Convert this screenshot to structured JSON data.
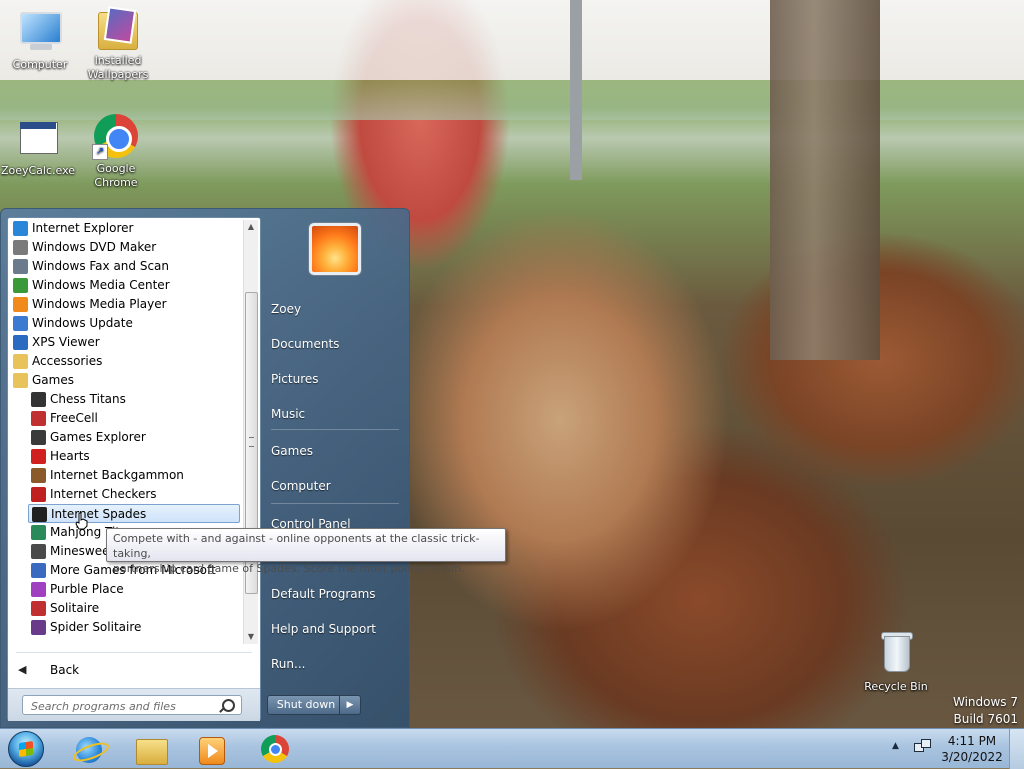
{
  "desktop": {
    "icons": [
      {
        "label": "Computer",
        "icon": "computer-icon"
      },
      {
        "label": "Installed Wallpapers",
        "icon": "folder-icon"
      },
      {
        "label": "ZoeyCalc.exe",
        "icon": "application-icon"
      },
      {
        "label": "Google Chrome",
        "icon": "chrome-icon"
      },
      {
        "label": "Recycle Bin",
        "icon": "recycle-bin-icon"
      }
    ],
    "watermark": {
      "line1": "Windows 7",
      "line2": "Build 7601"
    }
  },
  "start_menu": {
    "programs": [
      {
        "label": "Internet Explorer",
        "icon": "internet-explorer-icon",
        "color": "#2a86d8"
      },
      {
        "label": "Windows DVD Maker",
        "icon": "dvd-maker-icon",
        "color": "#7a7a7a"
      },
      {
        "label": "Windows Fax and Scan",
        "icon": "fax-scan-icon",
        "color": "#6b7b8b"
      },
      {
        "label": "Windows Media Center",
        "icon": "media-center-icon",
        "color": "#3a9a3a"
      },
      {
        "label": "Windows Media Player",
        "icon": "media-player-icon",
        "color": "#f08a1a"
      },
      {
        "label": "Windows Update",
        "icon": "windows-update-icon",
        "color": "#3a7ad0"
      },
      {
        "label": "XPS Viewer",
        "icon": "xps-viewer-icon",
        "color": "#2a6ac0"
      },
      {
        "label": "Accessories",
        "icon": "folder-icon",
        "color": "#e8c25a"
      },
      {
        "label": "Games",
        "icon": "folder-icon",
        "color": "#e8c25a"
      },
      {
        "label": "Chess Titans",
        "icon": "chess-icon",
        "color": "#333333",
        "indent": true
      },
      {
        "label": "FreeCell",
        "icon": "freecell-icon",
        "color": "#c03030",
        "indent": true
      },
      {
        "label": "Games Explorer",
        "icon": "games-explorer-icon",
        "color": "#3a3a3a",
        "indent": true
      },
      {
        "label": "Hearts",
        "icon": "hearts-icon",
        "color": "#d02020",
        "indent": true
      },
      {
        "label": "Internet Backgammon",
        "icon": "backgammon-icon",
        "color": "#8a5a2a",
        "indent": true
      },
      {
        "label": "Internet Checkers",
        "icon": "checkers-icon",
        "color": "#c02020",
        "indent": true
      },
      {
        "label": "Internet Spades",
        "icon": "spades-icon",
        "color": "#202020",
        "indent": true,
        "selected": true
      },
      {
        "label": "Mahjong Titans",
        "icon": "mahjong-icon",
        "color": "#2a8a5a",
        "indent": true
      },
      {
        "label": "Minesweeper",
        "icon": "minesweeper-icon",
        "color": "#4a4a4a",
        "indent": true
      },
      {
        "label": "More Games from Microsoft",
        "icon": "more-games-icon",
        "color": "#3a6ac0",
        "indent": true
      },
      {
        "label": "Purble Place",
        "icon": "purble-place-icon",
        "color": "#a040c0",
        "indent": true
      },
      {
        "label": "Solitaire",
        "icon": "solitaire-icon",
        "color": "#c03030",
        "indent": true
      },
      {
        "label": "Spider Solitaire",
        "icon": "spider-solitaire-icon",
        "color": "#6a3a8a",
        "indent": true
      }
    ],
    "back_label": "Back",
    "search_placeholder": "Search programs and files",
    "right_items": [
      {
        "label": "Zoey",
        "name": "start-right-zoey"
      },
      {
        "label": "Documents",
        "name": "start-right-documents"
      },
      {
        "label": "Pictures",
        "name": "start-right-pictures"
      },
      {
        "label": "Music",
        "name": "start-right-music"
      },
      {
        "label": "Games",
        "name": "start-right-games"
      },
      {
        "label": "Computer",
        "name": "start-right-computer"
      },
      {
        "label": "Control Panel",
        "name": "start-right-control-panel"
      },
      {
        "label": "Default Programs",
        "name": "start-right-default-programs"
      },
      {
        "label": "Help and Support",
        "name": "start-right-help-and-support"
      },
      {
        "label": "Run...",
        "name": "start-right-run"
      }
    ],
    "shutdown_label": "Shut down"
  },
  "tooltip": {
    "line1": "Compete with - and against - online opponents at the classic trick-taking,",
    "line2": "partnership card game of Spades. Score the most points to win."
  },
  "taskbar": {
    "pinned": [
      "internet-explorer-icon",
      "windows-explorer-icon",
      "media-player-icon",
      "chrome-icon"
    ],
    "clock": {
      "time": "4:11 PM",
      "date": "3/20/2022"
    }
  }
}
